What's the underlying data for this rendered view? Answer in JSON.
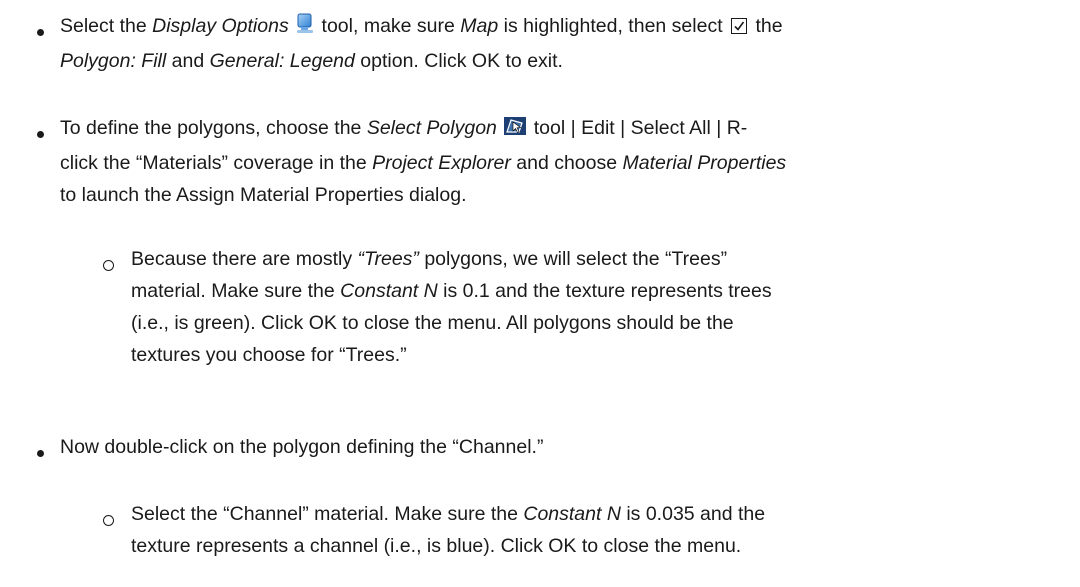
{
  "items": [
    {
      "a": "Select the ",
      "display_options": "Display Options",
      "b": " tool, make sure ",
      "map": "Map",
      "c": " is highlighted, then select",
      "d": " the",
      "polygon_fill": "Polygon: Fill",
      "e": " and ",
      "general_legend": "General: Legend",
      "f": " option. Click OK to exit."
    },
    {
      "a": "To define the polygons, choose the ",
      "select_polygon": "Select Polygon",
      "b": " tool | Edit | Select All | R-",
      "c": "click the “Materials” coverage in the ",
      "project_explorer": "Project Explorer",
      "d": " and choose ",
      "material_properties": "Material Properties",
      "e": "to launch the Assign Material Properties dialog."
    },
    {
      "a": "Because there are mostly ",
      "trees_italic": "“Trees”",
      "b": " polygons, we will select the “Trees”",
      "c": "material. Make sure the ",
      "constant_n": "Constant N",
      "d": " is 0.1 and the texture represents trees",
      "e": "(i.e., is green). Click OK to close the menu. All polygons should be the",
      "f": "textures you choose for “Trees.”"
    },
    {
      "a": "Now double-click on the polygon defining the “Channel.”"
    },
    {
      "a": "Select the “Channel” material. Make sure the ",
      "constant_n": "Constant N",
      "b": " is 0.035 and the",
      "c": "texture represents a channel (i.e., is blue). Click OK to close the menu."
    }
  ],
  "icons": {
    "display_options": "display-options-icon",
    "select_polygon": "select-polygon-icon",
    "checkbox": "checked-box"
  }
}
